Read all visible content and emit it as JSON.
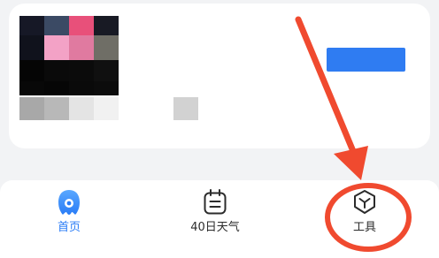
{
  "colors": {
    "accent_blue": "#2a7cf6",
    "banner_blue": "#2f7cf2",
    "annotation_red": "#f04a2f",
    "background": "#f2f3f5"
  },
  "tabbar": {
    "tabs": [
      {
        "label": "首页",
        "icon": "home-mascot-icon",
        "active": true
      },
      {
        "label": "40日天气",
        "icon": "calendar-icon",
        "active": false
      },
      {
        "label": "工具",
        "icon": "tools-icon",
        "active": false
      }
    ]
  }
}
